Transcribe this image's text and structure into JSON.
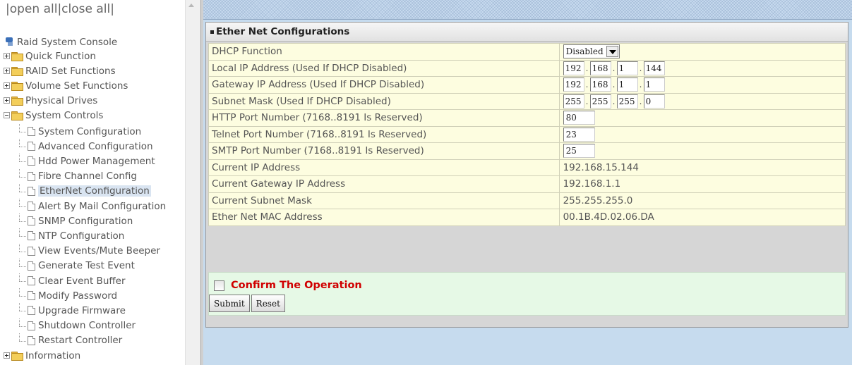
{
  "tree": {
    "open_all": "open all",
    "close_all": "close all",
    "root_label": "Raid System Console",
    "groups": [
      {
        "label": "Quick Function"
      },
      {
        "label": "RAID Set Functions"
      },
      {
        "label": "Volume Set Functions"
      },
      {
        "label": "Physical Drives"
      },
      {
        "label": "System Controls"
      }
    ],
    "system_controls_items": [
      {
        "label": "System Configuration"
      },
      {
        "label": "Advanced Configuration"
      },
      {
        "label": "Hdd Power Management"
      },
      {
        "label": "Fibre Channel Config"
      },
      {
        "label": "EtherNet Configuration"
      },
      {
        "label": "Alert By Mail Configuration"
      },
      {
        "label": "SNMP Configuration"
      },
      {
        "label": "NTP Configuration"
      },
      {
        "label": "View Events/Mute Beeper"
      },
      {
        "label": "Generate Test Event"
      },
      {
        "label": "Clear Event Buffer"
      },
      {
        "label": "Modify Password"
      },
      {
        "label": "Upgrade Firmware"
      },
      {
        "label": "Shutdown Controller"
      },
      {
        "label": "Restart Controller"
      }
    ],
    "information_label": "Information",
    "selected_item": "EtherNet Configuration"
  },
  "panel": {
    "title": "Ether Net Configurations",
    "rows": {
      "dhcp": {
        "label": "DHCP Function",
        "value": "Disabled"
      },
      "local_ip": {
        "label": "Local IP Address (Used If DHCP Disabled)",
        "octets": [
          "192",
          "168",
          "1",
          "144"
        ]
      },
      "gateway_ip": {
        "label": "Gateway IP Address (Used If DHCP Disabled)",
        "octets": [
          "192",
          "168",
          "1",
          "1"
        ]
      },
      "subnet": {
        "label": "Subnet Mask (Used If DHCP Disabled)",
        "octets": [
          "255",
          "255",
          "255",
          "0"
        ]
      },
      "http_port": {
        "label": "HTTP Port Number (7168..8191 Is Reserved)",
        "value": "80"
      },
      "telnet_port": {
        "label": "Telnet Port Number (7168..8191 Is Reserved)",
        "value": "23"
      },
      "smtp_port": {
        "label": "SMTP Port Number (7168..8191 Is Reserved)",
        "value": "25"
      },
      "current_ip": {
        "label": "Current IP Address",
        "value": "192.168.15.144"
      },
      "current_gateway": {
        "label": "Current Gateway IP Address",
        "value": "192.168.1.1"
      },
      "current_subnet": {
        "label": "Current Subnet Mask",
        "value": "255.255.255.0"
      },
      "mac": {
        "label": "Ether Net MAC Address",
        "value": "00.1B.4D.02.06.DA"
      }
    },
    "confirm_label": "Confirm The Operation",
    "submit_label": "Submit",
    "reset_label": "Reset"
  },
  "colors": {
    "row_bg": "#fdfde0",
    "confirm_bg": "#e6f9e6",
    "confirm_text": "#d00000",
    "frame_bg": "#c6dbee",
    "selected_bg": "#d9e4f1"
  }
}
